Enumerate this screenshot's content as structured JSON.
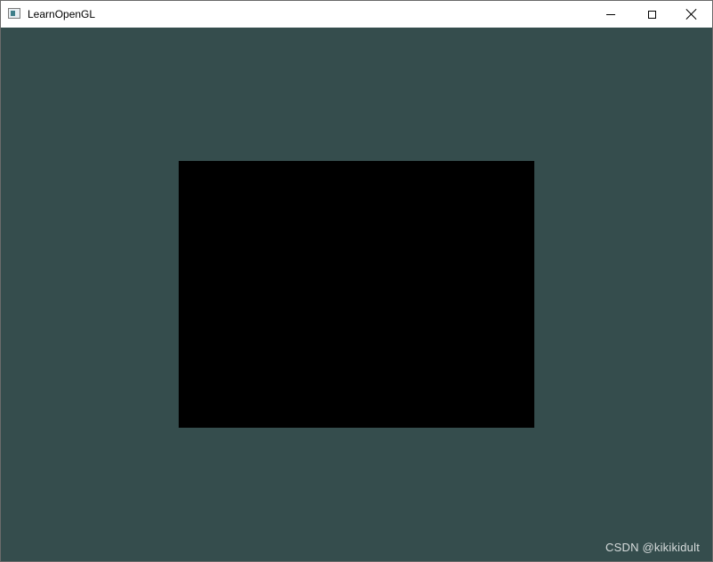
{
  "window": {
    "title": "LearnOpenGL",
    "app_icon": "window-app-icon",
    "controls": {
      "minimize_icon": "minimize-icon",
      "maximize_icon": "maximize-icon",
      "close_icon": "close-icon"
    }
  },
  "viewport": {
    "clear_color": "#354d4d",
    "rect_color": "#000000"
  },
  "watermark": {
    "text": "CSDN @kikikidult"
  }
}
